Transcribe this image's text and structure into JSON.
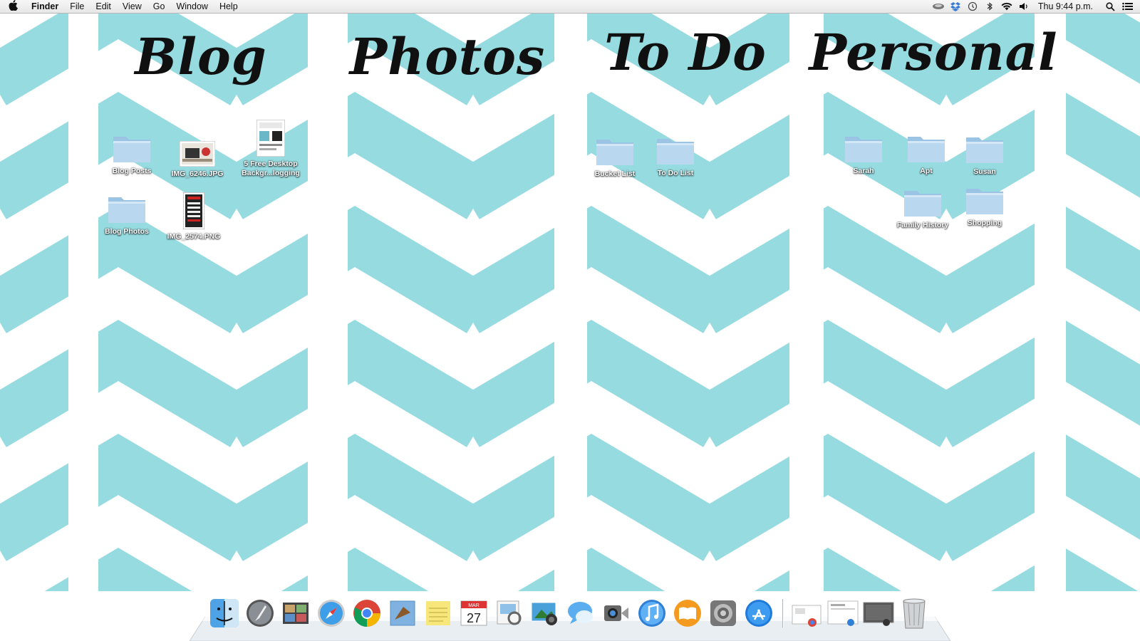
{
  "menubar": {
    "app_name": "Finder",
    "menus": [
      "File",
      "Edit",
      "View",
      "Go",
      "Window",
      "Help"
    ],
    "clock": "Thu 9:44 p.m.",
    "status_icons": [
      "glasses-icon",
      "dropbox-icon",
      "time-machine-icon",
      "bluetooth-icon",
      "wifi-icon",
      "volume-icon"
    ],
    "spotlight_icon": "search-icon",
    "notifications_icon": "list-icon"
  },
  "wallpaper": {
    "pattern": "chevron",
    "color_primary": "#95dbe0",
    "color_secondary": "#ffffff",
    "sections": [
      "Blog",
      "Photos",
      "To Do",
      "Personal"
    ]
  },
  "desktop_icons": {
    "blog": [
      {
        "label": "Blog Posts",
        "type": "folder"
      },
      {
        "label": "IMG_6246.JPG",
        "type": "image"
      },
      {
        "label": "5 Free Desktop Backgr...logging",
        "line1": "5 Free Desktop",
        "line2": "Backgr...logging",
        "type": "document"
      },
      {
        "label": "Blog Photos",
        "type": "folder"
      },
      {
        "label": "IMG_2574.PNG",
        "type": "image"
      }
    ],
    "todo": [
      {
        "label": "Bucket List",
        "type": "folder"
      },
      {
        "label": "To Do List",
        "type": "folder"
      }
    ],
    "personal": [
      {
        "label": "Sarah",
        "type": "folder"
      },
      {
        "label": "Apt",
        "type": "folder"
      },
      {
        "label": "Susan",
        "type": "folder"
      },
      {
        "label": "Family History",
        "type": "folder"
      },
      {
        "label": "Shopping",
        "type": "folder"
      }
    ]
  },
  "dock": {
    "apps": [
      "finder-icon",
      "launchpad-icon",
      "photo-booth-icon",
      "safari-icon",
      "chrome-icon",
      "mail-icon",
      "stickies-icon",
      "calendar-icon",
      "preview-icon",
      "iphoto-icon",
      "messages-icon",
      "facetime-icon",
      "itunes-icon",
      "ibooks-icon",
      "system-preferences-icon",
      "app-store-icon"
    ],
    "calendar_day": "27",
    "calendar_month": "MAR",
    "docs": [
      "downloads-stack-icon",
      "documents-stack-icon",
      "screen-stack-icon",
      "trash-icon"
    ]
  }
}
